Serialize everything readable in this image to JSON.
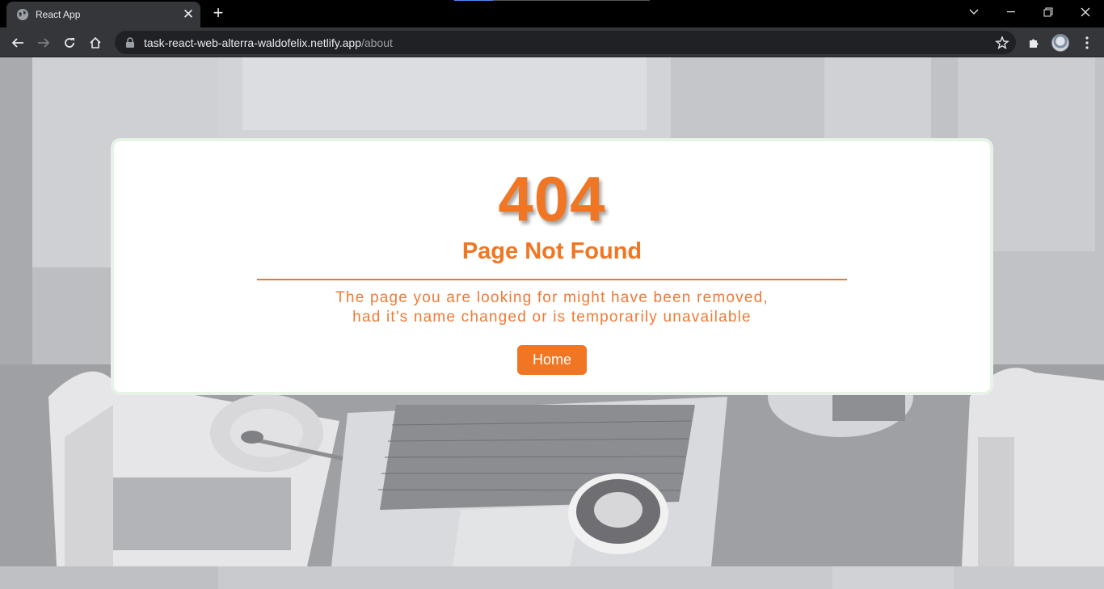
{
  "browser": {
    "tab_title": "React App",
    "url_host": "task-react-web-alterra-waldofelix.netlify.app",
    "url_path": "/about",
    "icons": [
      "globe-icon",
      "close-icon",
      "plus-icon",
      "chevron-down-icon",
      "minimize-icon",
      "restore-icon",
      "close-window-icon",
      "back-arrow-icon",
      "forward-arrow-icon",
      "reload-icon",
      "home-icon",
      "lock-icon",
      "star-icon",
      "puzzle-icon",
      "more-vert-icon"
    ]
  },
  "error_page": {
    "code": "404",
    "title": "Page Not Found",
    "message_line1": "The page you are looking for might have been removed,",
    "message_line2": "had it's name changed or is temporarily unavailable",
    "home_button": "Home"
  },
  "colors": {
    "accent": "#f07623",
    "card_border": "#e8f3e8",
    "chrome_dark": "#35363a",
    "omnibox": "#202124"
  }
}
